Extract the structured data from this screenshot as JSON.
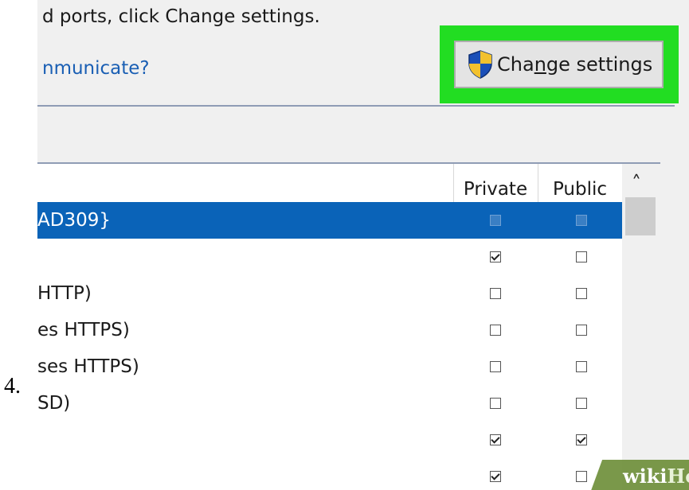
{
  "step": {
    "number": "4."
  },
  "header": {
    "instruction_text": "d ports, click Change settings.",
    "help_link": "nmunicate?"
  },
  "change_settings_button": {
    "label_pre": "Cha",
    "label_underlined": "n",
    "label_post": "ge settings",
    "icon": "uac-shield-icon",
    "highlight_color": "#22dd22"
  },
  "table": {
    "columns": {
      "private": "Private",
      "public": "Public"
    },
    "scroll_up_icon": "chevron-up-icon",
    "rows": [
      {
        "label": "AD309}",
        "private": false,
        "public": false,
        "selected": true
      },
      {
        "label": "",
        "private": true,
        "public": false,
        "selected": false
      },
      {
        "label": "HTTP)",
        "private": false,
        "public": false,
        "selected": false
      },
      {
        "label": "es HTTPS)",
        "private": false,
        "public": false,
        "selected": false
      },
      {
        "label": "ses HTTPS)",
        "private": false,
        "public": false,
        "selected": false
      },
      {
        "label": "SD)",
        "private": false,
        "public": false,
        "selected": false
      },
      {
        "label": "",
        "private": true,
        "public": true,
        "selected": false
      },
      {
        "label": "",
        "private": true,
        "public": false,
        "selected": false
      }
    ]
  },
  "watermark": {
    "wiki": "wiki",
    "how": "How"
  },
  "colors": {
    "selection": "#0a63b8",
    "link": "#1a5fb4"
  }
}
